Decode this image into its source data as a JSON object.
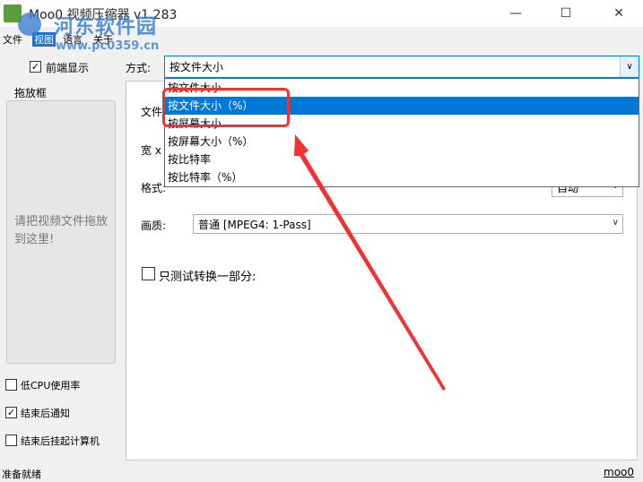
{
  "window": {
    "title": "Moo0 视频压缩器 v1.283",
    "minimize": "—",
    "maximize": "☐",
    "close": "✕"
  },
  "menu": [
    "文件",
    "视图",
    "语言",
    "关于"
  ],
  "watermark": {
    "name": "河东软件园",
    "url": "www.pc0359.cn"
  },
  "options": {
    "front": {
      "label": "前端显示",
      "checked": true
    },
    "low_cpu": {
      "label": "低CPU使用率",
      "checked": false
    },
    "notify": {
      "label": "结束后通知",
      "checked": true
    },
    "suspend": {
      "label": "结束后挂起计算机",
      "checked": false
    }
  },
  "dropbox": {
    "title": "拖放框",
    "hint": "请把视频文件拖放到这里!"
  },
  "method": {
    "label": "方式:",
    "value": "按文件大小"
  },
  "dropdown_options": [
    {
      "label": "按文件大小",
      "selected": false
    },
    {
      "label": "按文件大小（%）",
      "selected": true
    },
    {
      "label": "按屏幕大小",
      "selected": false
    },
    {
      "label": "按屏幕大小（%）",
      "selected": false
    },
    {
      "label": "按比特率",
      "selected": false
    },
    {
      "label": "按比特率（%）",
      "selected": false
    }
  ],
  "fields": {
    "file_label": "文件",
    "width_label": "宽 x",
    "format_label": "格式:",
    "format_value": "自动",
    "quality_label": "画质:",
    "quality_value": "普通  [MPEG4: 1-Pass]",
    "partial_label": "只测试转换一部分:",
    "partial_checked": false
  },
  "status": {
    "text": "准备就绪",
    "link": "moo0"
  },
  "check_glyph": "✓",
  "accent_color": "#0078d7",
  "annotation_color": "#f03232"
}
